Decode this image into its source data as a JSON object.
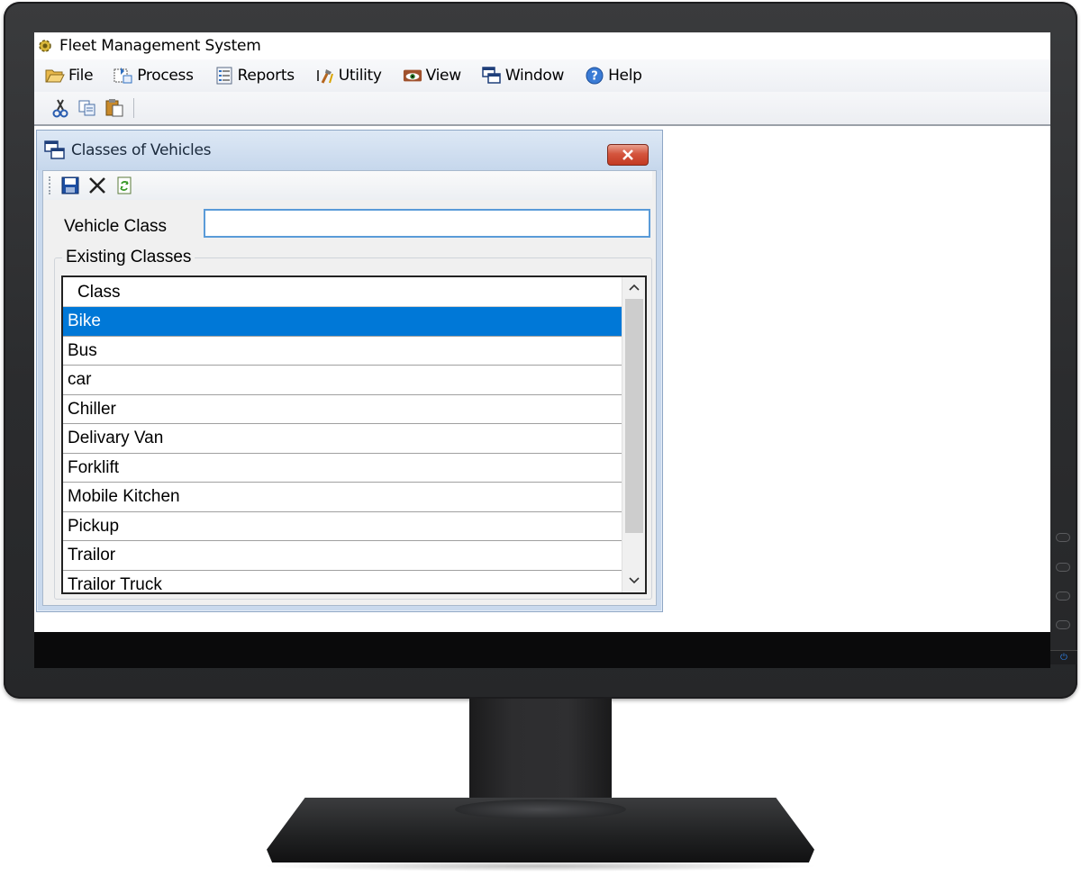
{
  "app": {
    "title": "Fleet Management System",
    "menu": [
      {
        "label": "File",
        "icon": "folder-open-icon"
      },
      {
        "label": "Process",
        "icon": "process-icon"
      },
      {
        "label": "Reports",
        "icon": "reports-icon"
      },
      {
        "label": "Utility",
        "icon": "tools-icon"
      },
      {
        "label": "View",
        "icon": "view-eye-icon"
      },
      {
        "label": "Window",
        "icon": "window-icon"
      },
      {
        "label": "Help",
        "icon": "help-icon"
      }
    ],
    "toolbar": [
      "cut-icon",
      "copy-icon",
      "paste-icon"
    ]
  },
  "child_window": {
    "title": "Classes of Vehicles",
    "toolbar": [
      "save-icon",
      "delete-icon",
      "refresh-icon"
    ],
    "vehicle_class_label": "Vehicle Class",
    "vehicle_class_value": "",
    "group_title": "Existing Classes",
    "grid": {
      "column_header": "Class",
      "rows": [
        "Bike",
        "Bus",
        "car",
        "Chiller",
        "Delivary Van",
        "Forklift",
        "Mobile Kitchen",
        "Pickup",
        "Trailor",
        "Trailor Truck"
      ],
      "selected": "Bike"
    }
  },
  "colors": {
    "selection": "#0078d7",
    "close_button": "#c9452d",
    "input_focus_border": "#5a9bd8",
    "child_frame": "#c9d9ed"
  }
}
